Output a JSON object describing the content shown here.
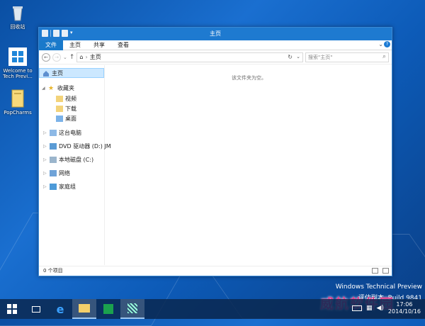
{
  "desktop": {
    "icons": [
      {
        "label": "回收站"
      },
      {
        "label": "Welcome to Tech Previ..."
      },
      {
        "label": "PopCharms"
      }
    ],
    "watermark_line1": "Windows Technical Preview",
    "watermark_line2": "评估副本. Build 9841",
    "brand_stamp": "威航软件园"
  },
  "window": {
    "title": "主页",
    "menu": [
      "文件",
      "主页",
      "共享",
      "查看"
    ],
    "address": "主页",
    "search_placeholder": "搜索\"主页\"",
    "empty_message": "该文件夹为空。",
    "status": "0 个项目",
    "nav": {
      "home": "主页",
      "favorites": "收藏夹",
      "fav_items": [
        "视频",
        "下载",
        "桌面"
      ],
      "this_pc": "这台电脑",
      "dvd": "DVD 驱动器 (D:) JM",
      "local_disk": "本地磁盘 (C:)",
      "network": "网络",
      "homegroup": "家庭组"
    }
  },
  "taskbar": {
    "time": "17:06",
    "date": "2014/10/16"
  },
  "colors": {
    "accent": "#1979ca",
    "titlebar": "#1e7ad0",
    "selection": "#cce8ff"
  }
}
